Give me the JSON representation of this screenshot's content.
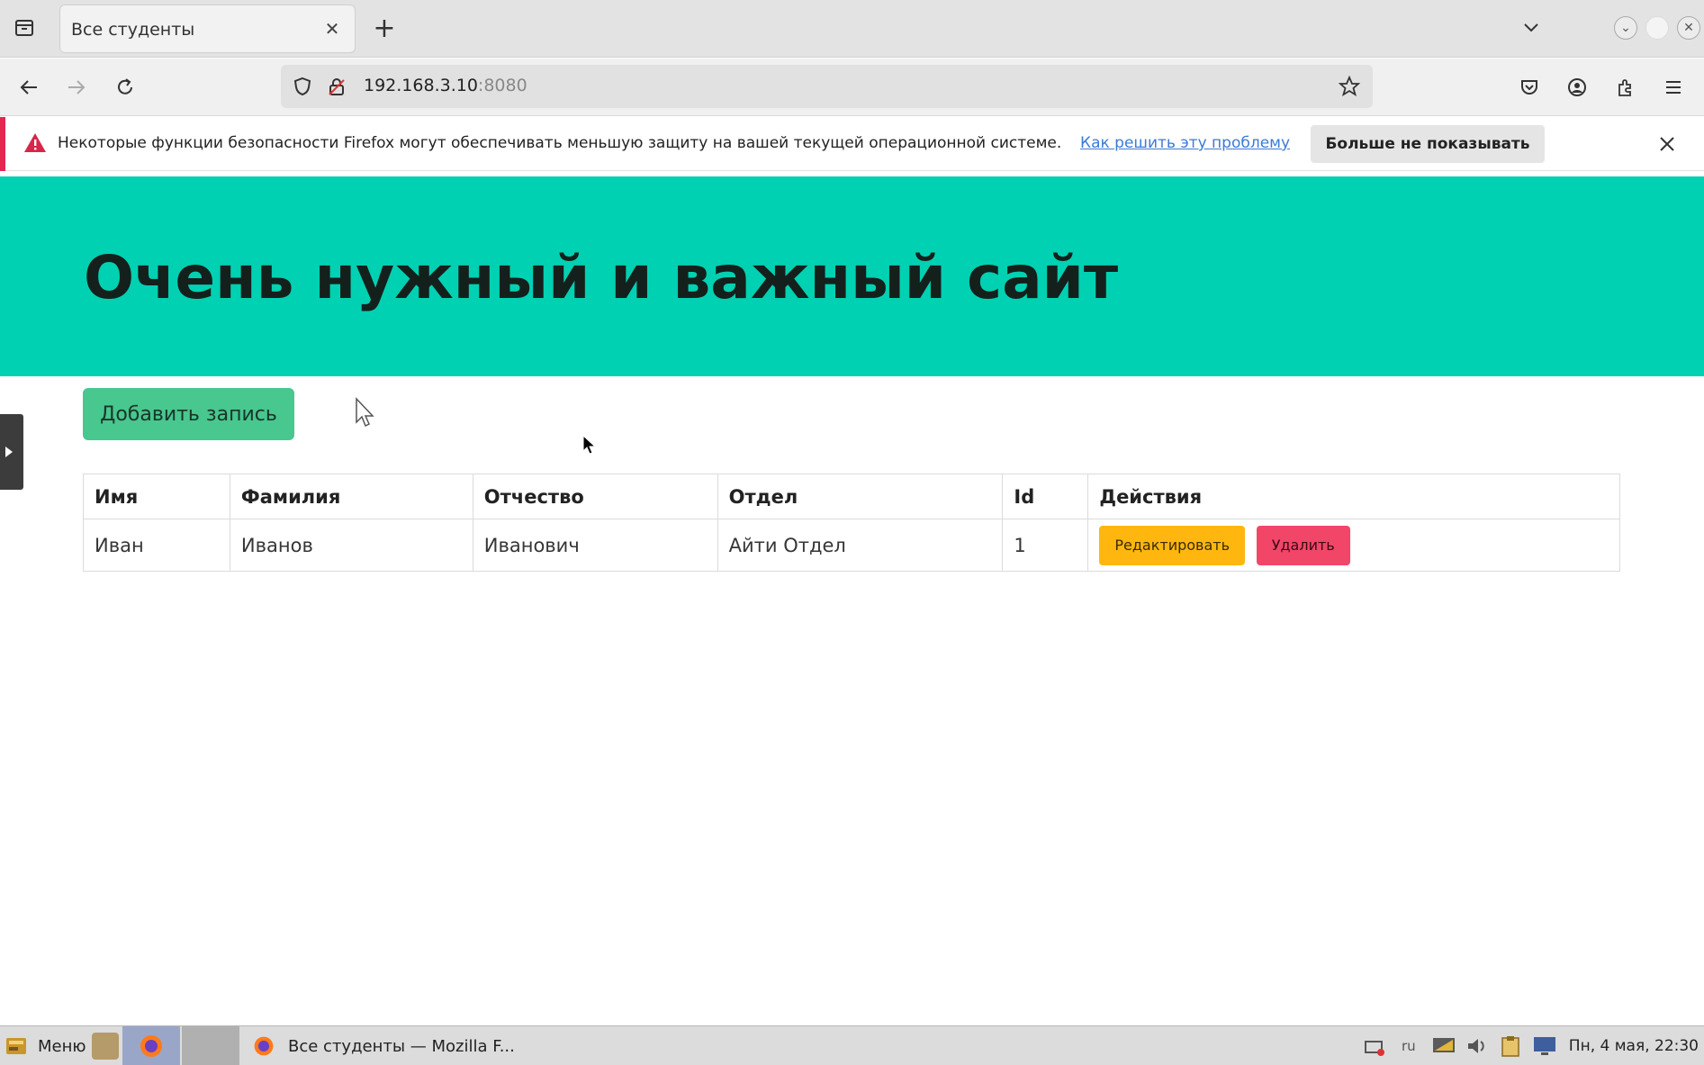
{
  "browser": {
    "tab_title": "Все студенты",
    "url_host": "192.168.3.10",
    "url_port": ":8080"
  },
  "notification": {
    "message": "Некоторые функции безопасности Firefox могут обеспечивать меньшую защиту на вашей текущей операционной системе.",
    "link": "Как решить эту проблему",
    "dismiss_label": "Больше не показывать"
  },
  "page": {
    "title": "Очень нужный и важный сайт",
    "add_button": "Добавить запись"
  },
  "table": {
    "headers": [
      "Имя",
      "Фамилия",
      "Отчество",
      "Отдел",
      "Id",
      "Действия"
    ],
    "rows": [
      {
        "first_name": "Иван",
        "last_name": "Иванов",
        "patronymic": "Иванович",
        "department": "Айти Отдел",
        "id": "1",
        "edit_label": "Редактировать",
        "delete_label": "Удалить"
      }
    ]
  },
  "taskbar": {
    "menu_label": "Меню",
    "window_label": "Все студенты — Mozilla F...",
    "lang": "ru",
    "clock": "Пн, 4 мая, 22:30"
  },
  "colors": {
    "hero": "#00d1b2",
    "add_button": "#48c78e",
    "edit_button": "#ffb70f",
    "delete_button": "#f14668"
  }
}
